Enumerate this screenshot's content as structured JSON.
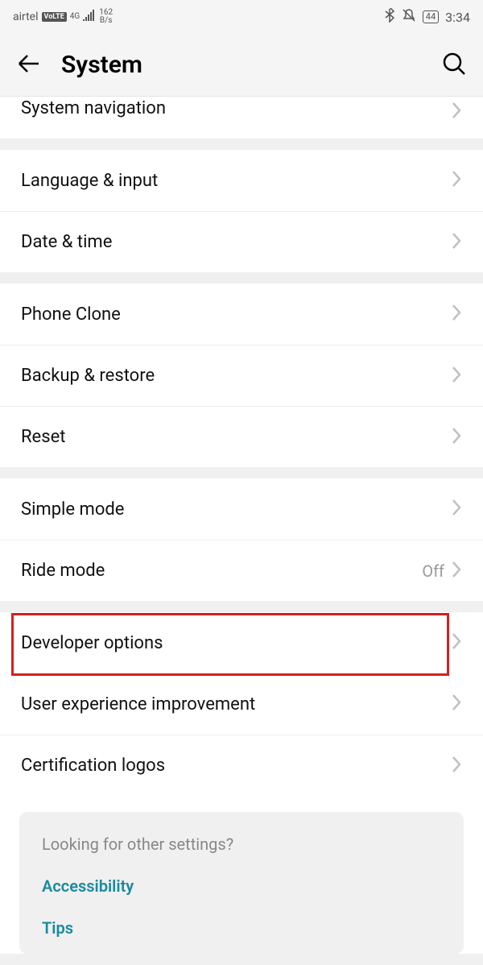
{
  "status_bar": {
    "carrier": "airtel",
    "volte": "VoLTE",
    "network": "4G",
    "speed_top": "162",
    "speed_bottom": "B/s",
    "battery": "44",
    "time": "3:34"
  },
  "header": {
    "title": "System"
  },
  "sections": {
    "partial": {
      "system_navigation": "System navigation"
    },
    "lang": {
      "language_input": "Language & input",
      "date_time": "Date & time"
    },
    "backup": {
      "phone_clone": "Phone Clone",
      "backup_restore": "Backup & restore",
      "reset": "Reset"
    },
    "mode": {
      "simple_mode": "Simple mode",
      "ride_mode": "Ride mode",
      "ride_mode_value": "Off"
    },
    "dev": {
      "developer_options": "Developer options",
      "user_experience": "User experience improvement",
      "certification": "Certification logos"
    }
  },
  "footer": {
    "title": "Looking for other settings?",
    "accessibility": "Accessibility",
    "tips": "Tips"
  }
}
